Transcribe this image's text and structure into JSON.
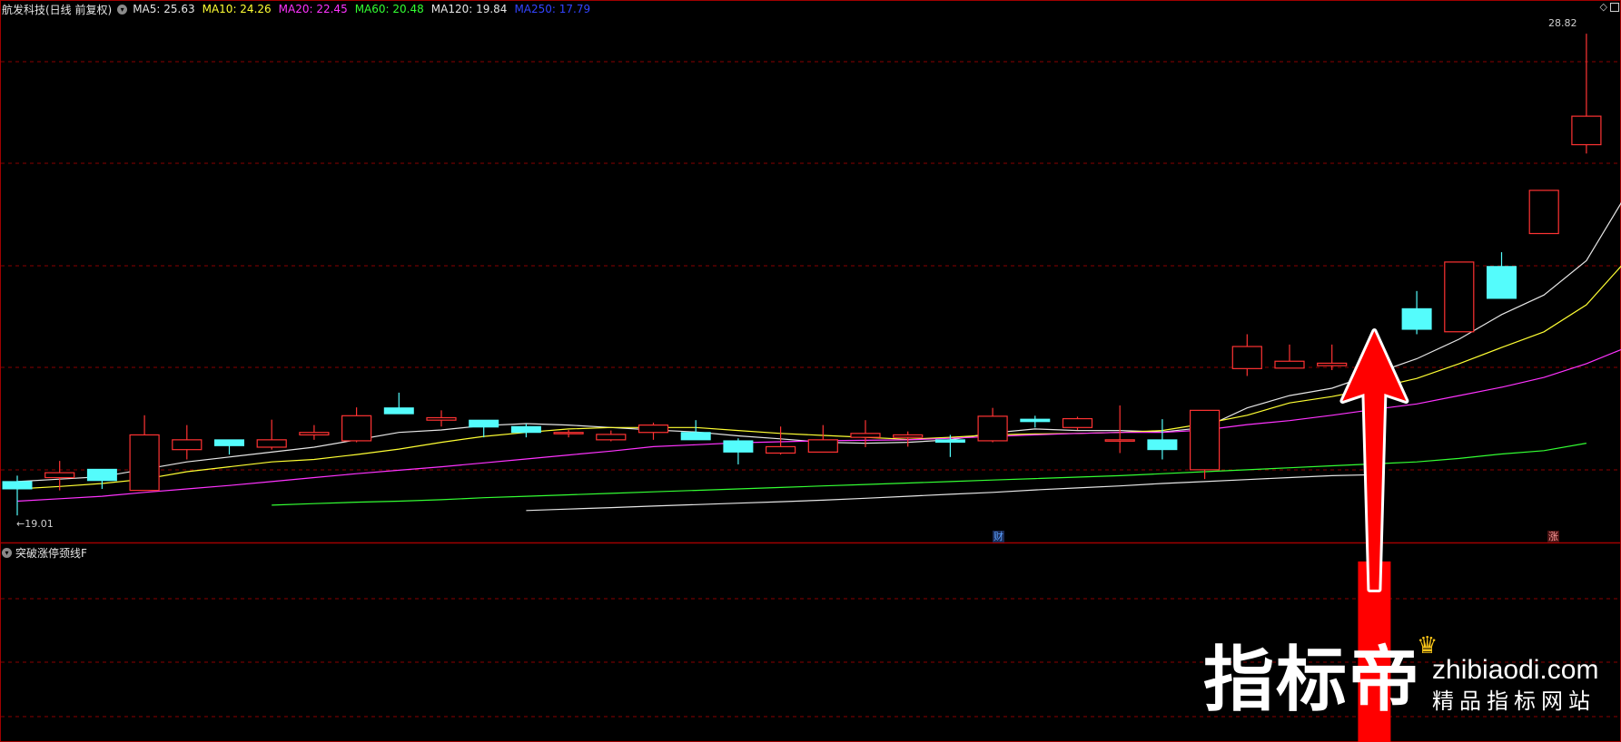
{
  "legend": {
    "title": "航发科技(日线 前复权)",
    "ma_items": [
      {
        "label": "MA5: 25.63",
        "color": "#e6e6e6"
      },
      {
        "label": "MA10: 24.26",
        "color": "#ffff33"
      },
      {
        "label": "MA20: 22.45",
        "color": "#ff33ff"
      },
      {
        "label": "MA60: 20.48",
        "color": "#33ff33"
      },
      {
        "label": "MA120: 19.84",
        "color": "#e6e6e6"
      },
      {
        "label": "MA250: 17.79",
        "color": "#3344ff"
      }
    ]
  },
  "sub_panel": {
    "title": "突破涨停颈线F"
  },
  "labels": {
    "high": "28.82",
    "low": "19.01"
  },
  "event_tags": {
    "cai": "财",
    "zhang": "涨"
  },
  "watermark": {
    "brand": "指标帝",
    "domain": "zhibiaodi.com",
    "slogan": "精品指标网站"
  },
  "colors": {
    "up": "#ff3333",
    "down": "#54fcfc",
    "grid": "#8a0000",
    "border": "#a00000",
    "ma5": "#e6e6e6",
    "ma10": "#ffff33",
    "ma20": "#ff33ff",
    "ma60": "#33ff33",
    "ma120": "#e6e6e6",
    "arrow": "#ff0000",
    "signal_bar": "#ff0000"
  },
  "chart_data": {
    "type": "candlestick",
    "y_range": [
      18.7,
      29.1
    ],
    "candles": [
      {
        "o": 19.7,
        "c": 19.55,
        "h": 19.82,
        "l": 19.01
      },
      {
        "o": 19.78,
        "c": 19.88,
        "h": 20.12,
        "l": 19.52
      },
      {
        "o": 19.95,
        "c": 19.72,
        "h": 19.95,
        "l": 19.55
      },
      {
        "o": 19.52,
        "c": 20.65,
        "h": 21.05,
        "l": 19.52
      },
      {
        "o": 20.35,
        "c": 20.55,
        "h": 20.85,
        "l": 20.15
      },
      {
        "o": 20.55,
        "c": 20.43,
        "h": 20.55,
        "l": 20.25
      },
      {
        "o": 20.4,
        "c": 20.55,
        "h": 20.96,
        "l": 20.35
      },
      {
        "o": 20.65,
        "c": 20.7,
        "h": 20.85,
        "l": 20.55
      },
      {
        "o": 20.53,
        "c": 21.04,
        "h": 21.21,
        "l": 20.5
      },
      {
        "o": 21.2,
        "c": 21.08,
        "h": 21.51,
        "l": 21.08
      },
      {
        "o": 20.95,
        "c": 21.0,
        "h": 21.15,
        "l": 20.82
      },
      {
        "o": 20.95,
        "c": 20.81,
        "h": 20.95,
        "l": 20.6
      },
      {
        "o": 20.82,
        "c": 20.7,
        "h": 20.88,
        "l": 20.6
      },
      {
        "o": 20.7,
        "c": 20.7,
        "h": 20.75,
        "l": 20.6
      },
      {
        "o": 20.55,
        "c": 20.66,
        "h": 20.74,
        "l": 20.52
      },
      {
        "o": 20.7,
        "c": 20.85,
        "h": 20.9,
        "l": 20.55
      },
      {
        "o": 20.7,
        "c": 20.55,
        "h": 20.95,
        "l": 20.55
      },
      {
        "o": 20.53,
        "c": 20.3,
        "h": 20.58,
        "l": 20.05
      },
      {
        "o": 20.28,
        "c": 20.41,
        "h": 20.82,
        "l": 20.25
      },
      {
        "o": 20.3,
        "c": 20.55,
        "h": 20.85,
        "l": 20.3
      },
      {
        "o": 20.6,
        "c": 20.68,
        "h": 20.95,
        "l": 20.4
      },
      {
        "o": 20.6,
        "c": 20.65,
        "h": 20.72,
        "l": 20.41
      },
      {
        "o": 20.55,
        "c": 20.5,
        "h": 20.65,
        "l": 20.2
      },
      {
        "o": 20.53,
        "c": 21.03,
        "h": 21.2,
        "l": 20.5
      },
      {
        "o": 20.97,
        "c": 20.92,
        "h": 21.04,
        "l": 20.8
      },
      {
        "o": 20.8,
        "c": 20.98,
        "h": 21.02,
        "l": 20.75
      },
      {
        "o": 20.55,
        "c": 20.55,
        "h": 21.25,
        "l": 20.28
      },
      {
        "o": 20.55,
        "c": 20.35,
        "h": 20.97,
        "l": 20.15
      },
      {
        "o": 19.94,
        "c": 21.15,
        "h": 21.15,
        "l": 19.75
      },
      {
        "o": 22.0,
        "c": 22.45,
        "h": 22.7,
        "l": 21.85
      },
      {
        "o": 22.01,
        "c": 22.15,
        "h": 22.49,
        "l": 22.01
      },
      {
        "o": 22.06,
        "c": 22.11,
        "h": 22.49,
        "l": 21.97
      },
      {
        "o": 22.06,
        "c": 21.99,
        "h": 22.65,
        "l": 21.9
      },
      {
        "o": 23.22,
        "c": 22.8,
        "h": 23.58,
        "l": 22.7
      },
      {
        "o": 22.75,
        "c": 24.17,
        "h": 24.17,
        "l": 22.75
      },
      {
        "o": 24.08,
        "c": 23.43,
        "h": 24.37,
        "l": 23.43
      },
      {
        "o": 24.75,
        "c": 25.63,
        "h": 25.63,
        "l": 24.75
      },
      {
        "o": 26.56,
        "c": 27.14,
        "h": 28.82,
        "l": 26.38
      }
    ],
    "ma_lines": [
      {
        "name": "MA5",
        "values": [
          19.7,
          19.75,
          19.8,
          19.95,
          20.1,
          20.2,
          20.3,
          20.4,
          20.55,
          20.7,
          20.75,
          20.84,
          20.88,
          20.85,
          20.8,
          20.75,
          20.71,
          20.63,
          20.57,
          20.5,
          20.48,
          20.5,
          20.55,
          20.69,
          20.77,
          20.74,
          20.74,
          20.71,
          20.8,
          21.2,
          21.45,
          21.6,
          21.9,
          22.2,
          22.6,
          23.1,
          23.5,
          24.2,
          25.63
        ],
        "start": 0
      },
      {
        "name": "MA10",
        "values": [
          19.55,
          19.6,
          19.66,
          19.75,
          19.9,
          20.0,
          20.1,
          20.15,
          20.25,
          20.36,
          20.5,
          20.62,
          20.7,
          20.77,
          20.8,
          20.8,
          20.8,
          20.74,
          20.68,
          20.64,
          20.6,
          20.56,
          20.6,
          20.65,
          20.67,
          20.68,
          20.7,
          20.74,
          20.88,
          21.05,
          21.3,
          21.43,
          21.6,
          21.8,
          22.1,
          22.43,
          22.75,
          23.3,
          24.26
        ],
        "start": 0
      },
      {
        "name": "MA20",
        "values": [
          19.3,
          19.35,
          19.4,
          19.48,
          19.55,
          19.62,
          19.7,
          19.78,
          19.86,
          19.93,
          20.0,
          20.08,
          20.16,
          20.24,
          20.32,
          20.41,
          20.45,
          20.49,
          20.51,
          20.53,
          20.54,
          20.55,
          20.58,
          20.62,
          20.65,
          20.68,
          20.7,
          20.7,
          20.75,
          20.86,
          20.94,
          21.05,
          21.17,
          21.28,
          21.45,
          21.62,
          21.82,
          22.1,
          22.45
        ],
        "start": 0
      },
      {
        "name": "MA60",
        "values": [
          19.22,
          19.25,
          19.28,
          19.3,
          19.33,
          19.37,
          19.4,
          19.43,
          19.46,
          19.49,
          19.52,
          19.55,
          19.58,
          19.61,
          19.64,
          19.67,
          19.7,
          19.73,
          19.76,
          19.79,
          19.82,
          19.86,
          19.9,
          19.94,
          19.98,
          20.02,
          20.06,
          20.1,
          20.17,
          20.26,
          20.33,
          20.48
        ],
        "start": 6
      },
      {
        "name": "MA120",
        "values": [
          19.11,
          19.14,
          19.17,
          19.2,
          19.23,
          19.26,
          19.29,
          19.32,
          19.36,
          19.4,
          19.44,
          19.48,
          19.53,
          19.57,
          19.61,
          19.66,
          19.7,
          19.74,
          19.78,
          19.82,
          19.84
        ],
        "start": 12
      }
    ]
  }
}
